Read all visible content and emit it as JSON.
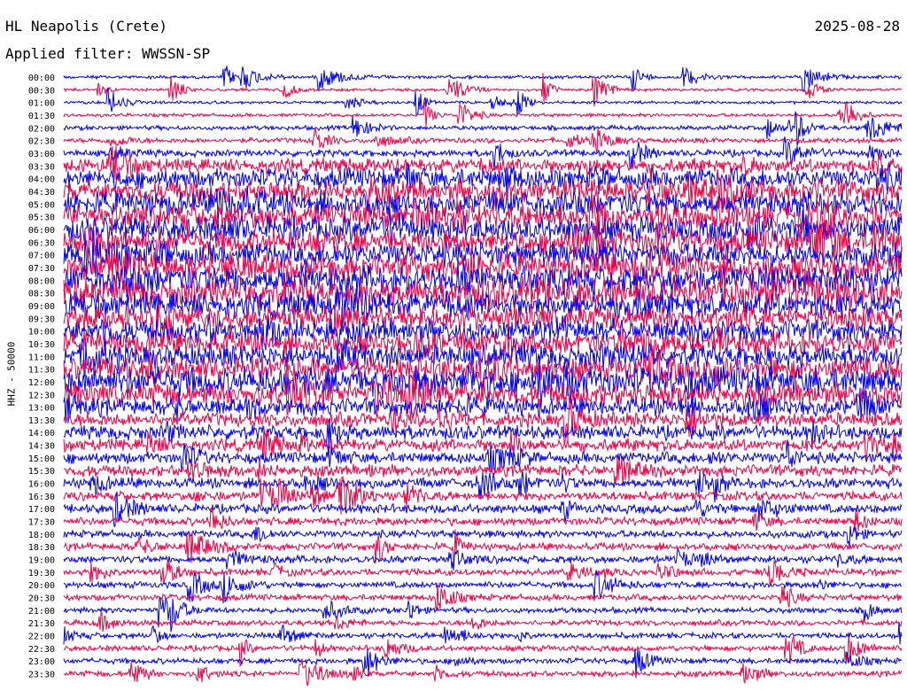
{
  "header": {
    "station": "HL Neapolis (Crete)",
    "filter": "Applied filter: WWSSN-SP",
    "date": "2025-08-28"
  },
  "chart_data": {
    "type": "line",
    "title": "HL Neapolis (Crete)",
    "ylabel": "HHZ - 50000",
    "trace_colors": [
      "#0000ee",
      "#ee0044"
    ],
    "y_tick_labels": [
      "00:00",
      "00:30",
      "01:00",
      "01:30",
      "02:00",
      "02:30",
      "03:00",
      "03:30",
      "04:00",
      "04:30",
      "05:00",
      "05:30",
      "06:00",
      "06:30",
      "07:00",
      "07:30",
      "08:00",
      "08:30",
      "09:00",
      "09:30",
      "10:00",
      "10:30",
      "11:00",
      "11:30",
      "12:00",
      "12:30",
      "13:00",
      "13:30",
      "14:00",
      "14:30",
      "15:00",
      "15:30",
      "16:00",
      "16:30",
      "17:00",
      "17:30",
      "18:00",
      "18:30",
      "19:00",
      "19:30",
      "20:00",
      "20:30",
      "21:00",
      "21:30",
      "22:00",
      "22:30",
      "23:00",
      "23:30"
    ],
    "relative_noise_amplitude": [
      0.6,
      0.5,
      0.5,
      0.6,
      0.8,
      0.9,
      1.2,
      2.5,
      3.5,
      4.0,
      4.2,
      4.5,
      4.5,
      4.3,
      4.3,
      4.6,
      5.0,
      5.0,
      4.5,
      4.3,
      4.0,
      4.0,
      4.0,
      4.2,
      5.0,
      4.2,
      3.0,
      2.5,
      2.5,
      2.2,
      2.0,
      2.0,
      1.8,
      1.6,
      1.6,
      1.4,
      1.3,
      1.3,
      1.3,
      1.2,
      1.1,
      1.1,
      1.0,
      1.0,
      1.0,
      1.0,
      1.0,
      1.0
    ],
    "grid": false
  }
}
